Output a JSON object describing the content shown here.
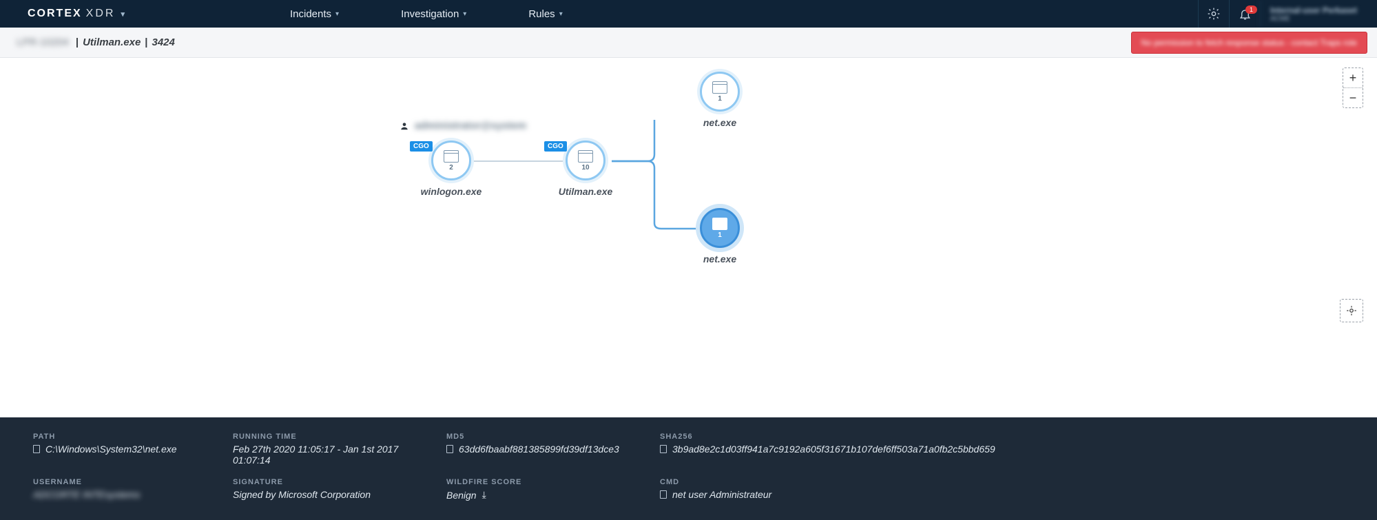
{
  "nav": {
    "brand_main": "CORTEX",
    "brand_sub": "XDR",
    "items": [
      "Incidents",
      "Investigation",
      "Rules"
    ],
    "notif_count": "1",
    "user_line1": "Internal-user Perkaset",
    "user_line2": "ACME"
  },
  "breadcrumb": {
    "host": "LPR-10204",
    "process": "Utilman.exe",
    "pid": "3424"
  },
  "banner": {
    "text": "No permission to fetch response status - contact Traps role"
  },
  "tree": {
    "user_label": "administrator@system",
    "nodes": [
      {
        "id": "winlogon",
        "label": "winlogon.exe",
        "count": "2",
        "tag": "CGO"
      },
      {
        "id": "utilman",
        "label": "Utilman.exe",
        "count": "10",
        "tag": "CGO"
      },
      {
        "id": "net1",
        "label": "net.exe",
        "count": "1"
      },
      {
        "id": "net2",
        "label": "net.exe",
        "count": "1",
        "selected": true
      }
    ]
  },
  "details": {
    "path_label": "PATH",
    "path": "C:\\Windows\\System32\\net.exe",
    "running_label": "RUNNING TIME",
    "running": "Feb 27th 2020 11:05:17 - Jan 1st 2017 01:07:14",
    "md5_label": "MD5",
    "md5": "63dd6fbaabf881385899fd39df13dce3",
    "sha_label": "SHA256",
    "sha": "3b9ad8e2c1d03ff941a7c9192a605f31671b107def6ff503a71a0fb2c5bbd659",
    "username_label": "USERNAME",
    "username": "ADCORTE INTEsystems",
    "sig_label": "SIGNATURE",
    "sig": "Signed by Microsoft Corporation",
    "wf_label": "WILDFIRE SCORE",
    "wf": "Benign",
    "cmd_label": "CMD",
    "cmd": "net user Administrateur"
  }
}
